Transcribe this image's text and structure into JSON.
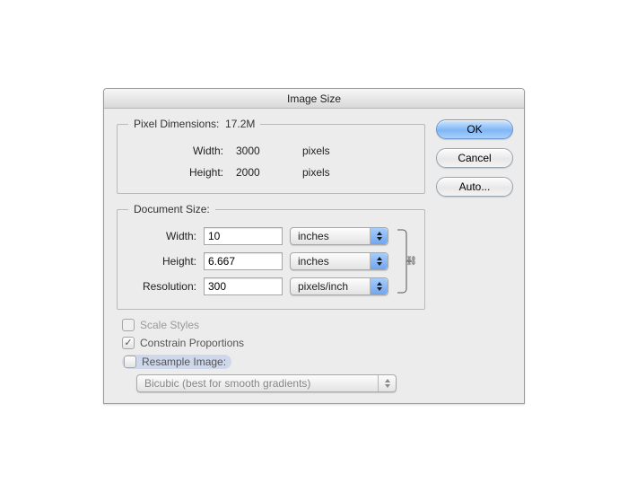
{
  "dialog": {
    "title": "Image Size"
  },
  "buttons": {
    "ok": "OK",
    "cancel": "Cancel",
    "auto": "Auto..."
  },
  "pixelDimensions": {
    "legend": "Pixel Dimensions:",
    "size": "17.2M",
    "widthLabel": "Width:",
    "widthValue": "3000",
    "widthUnit": "pixels",
    "heightLabel": "Height:",
    "heightValue": "2000",
    "heightUnit": "pixels"
  },
  "documentSize": {
    "legend": "Document Size:",
    "widthLabel": "Width:",
    "widthValue": "10",
    "widthUnit": "inches",
    "heightLabel": "Height:",
    "heightValue": "6.667",
    "heightUnit": "inches",
    "resolutionLabel": "Resolution:",
    "resolutionValue": "300",
    "resolutionUnit": "pixels/inch"
  },
  "options": {
    "scaleStyles": "Scale Styles",
    "constrainProportions": "Constrain Proportions",
    "resampleImage": "Resample Image:",
    "resampleMethod": "Bicubic (best for smooth gradients)"
  },
  "checks": {
    "constrainProportionsMark": "✓"
  }
}
